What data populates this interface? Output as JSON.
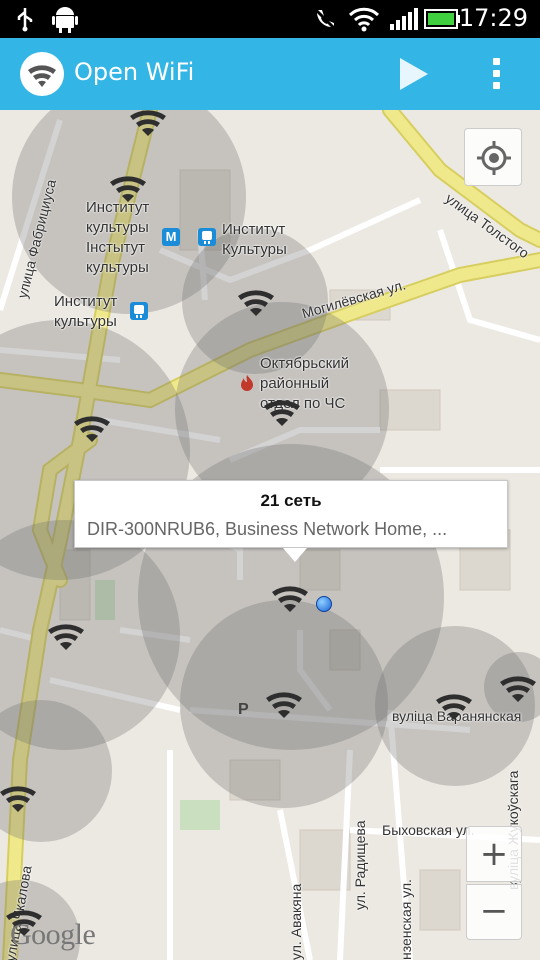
{
  "status_bar": {
    "time": "17:29"
  },
  "app_bar": {
    "title": "Open WiFi"
  },
  "map": {
    "info_window": {
      "title": "21 сеть",
      "subtitle": "DIR-300NRUB6, Business Network Home, ..."
    },
    "poi_labels": {
      "institute_1": "Институт\nкультуры\nІнстытут\nкультуры",
      "institute_2": "Институт\nКультуры",
      "institute_3": "Институт\nкультуры",
      "fire_dept": "Октябрьский\nрайонный\nотдел по ЧС",
      "metro_glyph": "М",
      "parking": "P"
    },
    "streets": {
      "fabriciusa": "улица Фабрициуса",
      "tolstogo": "улица Толстого",
      "mogilevskaya": "Могилёвская ул.",
      "varanyanskaya": "вуліца Варанянская",
      "zhukouskaga": "вуліца Жукоўскага",
      "bykhovskaya": "Быховская ул.",
      "radishcheva": "ул. Радищева",
      "avakyana": "ул. Авакяна",
      "chkalova": "улица Чкалова",
      "nzenskaya": "нзенская ул."
    },
    "attribution": "Google",
    "zoom_in_label": "+",
    "zoom_out_label": "−"
  },
  "colors": {
    "app_bar": "#33b5e5",
    "map_background": "#ece9e3",
    "major_road": "#eae27a",
    "wifi_circle": "#6e6e6e"
  },
  "icons": [
    "usb-icon",
    "android-icon",
    "mute-icon",
    "wifi-status-icon",
    "signal-icon",
    "battery-icon",
    "wifi-logo-icon",
    "play-icon",
    "overflow-menu-icon",
    "locate-icon",
    "wifi-hotspot-icon",
    "metro-icon",
    "rail-icon",
    "fire-icon"
  ]
}
